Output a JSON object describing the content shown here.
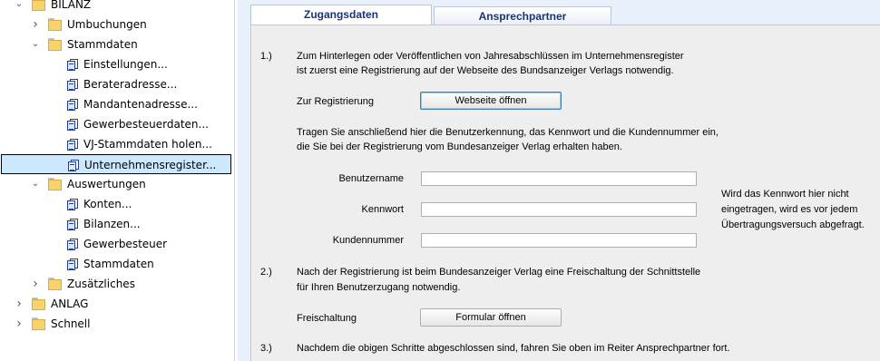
{
  "tree": {
    "items": [
      {
        "label": "BILANZ",
        "type": "folder",
        "expanded": true,
        "level": 0
      },
      {
        "label": "Umbuchungen",
        "type": "folder",
        "expanded": false,
        "level": 1
      },
      {
        "label": "Stammdaten",
        "type": "folder",
        "expanded": true,
        "level": 1
      },
      {
        "label": "Einstellungen...",
        "type": "doc",
        "level": 2
      },
      {
        "label": "Berateradresse...",
        "type": "doc",
        "level": 2
      },
      {
        "label": "Mandantenadresse...",
        "type": "doc",
        "level": 2
      },
      {
        "label": "Gewerbesteuerdaten...",
        "type": "doc",
        "level": 2
      },
      {
        "label": "VJ-Stammdaten holen...",
        "type": "doc",
        "level": 2
      },
      {
        "label": "Unternehmensregister...",
        "type": "doc",
        "level": 2,
        "selected": true
      },
      {
        "label": "Auswertungen",
        "type": "folder",
        "expanded": true,
        "level": 1
      },
      {
        "label": "Konten...",
        "type": "doc",
        "level": 2
      },
      {
        "label": "Bilanzen...",
        "type": "doc",
        "level": 2
      },
      {
        "label": "Gewerbesteuer",
        "type": "doc",
        "level": 2
      },
      {
        "label": "Stammdaten",
        "type": "doc",
        "level": 2
      },
      {
        "label": "Zusätzliches",
        "type": "folder",
        "expanded": false,
        "level": 1
      },
      {
        "label": "ANLAG",
        "type": "folder",
        "expanded": false,
        "level": 0
      },
      {
        "label": "Schnell",
        "type": "folder",
        "expanded": false,
        "level": 0
      }
    ]
  },
  "tabs": {
    "zugangsdaten": "Zugangsdaten",
    "ansprechpartner": "Ansprechpartner"
  },
  "step1": {
    "num": "1.)",
    "line1": "Zum Hinterlegen oder Veröffentlichen von Jahresabschlüssen im Unternehmensregister",
    "line2": "ist zuerst eine Registrierung auf der Webseite des Bundsanzeiger Verlags notwendig.",
    "reg_label": "Zur Registrierung",
    "reg_button": "Webseite öffnen",
    "info1": "Tragen Sie anschließend hier die Benutzerkennung, das Kennwort und die Kundennummer ein,",
    "info2": "die Sie bei der Registrierung vom Bundesanzeiger Verlag erhalten haben.",
    "benutzername_label": "Benutzername",
    "benutzername_value": "",
    "kennwort_label": "Kennwort",
    "kennwort_value": "",
    "kundennummer_label": "Kundennummer",
    "kundennummer_value": "",
    "hint1": "Wird das Kennwort hier nicht",
    "hint2": "eingetragen, wird es vor jedem",
    "hint3": "Übertragungsversuch abgefragt."
  },
  "step2": {
    "num": "2.)",
    "line1": "Nach der Registrierung ist beim Bundesanzeiger Verlag eine Freischaltung der Schnittstelle",
    "line2": "für Ihren Benutzerzugang notwendig.",
    "label": "Freischaltung",
    "button": "Formular öffnen"
  },
  "step3": {
    "num": "3.)",
    "line1": "Nachdem die obigen Schritte abgeschlossen sind, fahren Sie oben im Reiter Ansprechpartner fort."
  }
}
